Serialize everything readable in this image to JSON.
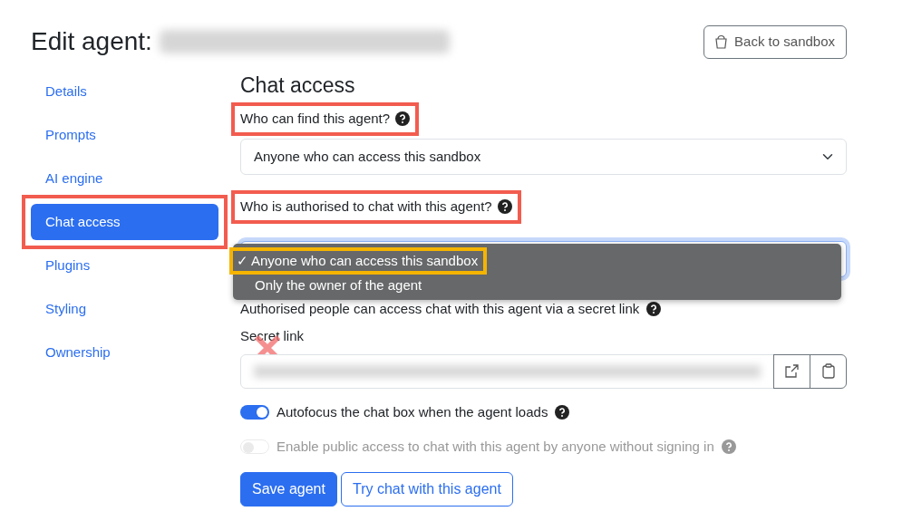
{
  "header": {
    "title": "Edit agent:",
    "back_button": "Back to sandbox"
  },
  "sidebar": {
    "items": [
      {
        "label": "Details",
        "selected": false,
        "highlighted": false
      },
      {
        "label": "Prompts",
        "selected": false,
        "highlighted": false
      },
      {
        "label": "AI engine",
        "selected": false,
        "highlighted": false
      },
      {
        "label": "Chat access",
        "selected": true,
        "highlighted": true
      },
      {
        "label": "Plugins",
        "selected": false,
        "highlighted": false
      },
      {
        "label": "Styling",
        "selected": false,
        "highlighted": false
      },
      {
        "label": "Ownership",
        "selected": false,
        "highlighted": false
      }
    ]
  },
  "section": {
    "heading": "Chat access",
    "find": {
      "label": "Who can find this agent?",
      "highlighted": true,
      "value": "Anyone who can access this sandbox"
    },
    "authorised": {
      "label": "Who is authorised to chat with this agent?",
      "highlighted": true,
      "expanded": true,
      "check_mark": "✓",
      "options": [
        {
          "label": "Anyone who can access this sandbox",
          "selected": true,
          "highlighted": true
        },
        {
          "label": "Only the owner of the agent",
          "selected": false,
          "highlighted": false
        }
      ]
    },
    "help": "Authorised people can access chat with this agent via a secret link",
    "secret_link": {
      "label": "Secret link",
      "crossed": true
    },
    "toggles": [
      {
        "label": "Autofocus the chat box when the agent loads",
        "on": true,
        "disabled": false
      },
      {
        "label": "Enable public access to chat with this agent by anyone without signing in",
        "on": false,
        "disabled": true
      }
    ],
    "buttons": [
      {
        "label": "Save agent",
        "kind": "primary"
      },
      {
        "label": "Try chat with this agent",
        "kind": "outline"
      }
    ]
  }
}
